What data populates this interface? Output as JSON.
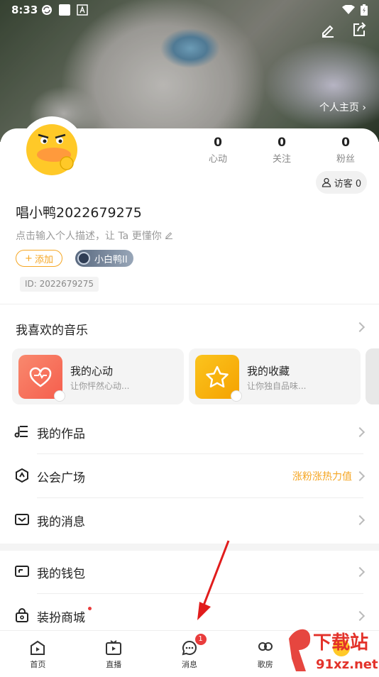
{
  "status_bar": {
    "time": "8:33"
  },
  "header": {
    "homepage_link": "个人主页"
  },
  "profile": {
    "stats": [
      {
        "num": "0",
        "label": "心动"
      },
      {
        "num": "0",
        "label": "关注"
      },
      {
        "num": "0",
        "label": "粉丝"
      }
    ],
    "visitor_label": "访客 0",
    "username": "唱小鸭2022679275",
    "description": "点击输入个人描述，让 Ta 更懂你",
    "add_label": "添加",
    "level_label": "小白鸭II",
    "uid": "ID: 2022679275"
  },
  "music": {
    "section_title": "我喜欢的音乐",
    "cards": [
      {
        "title": "我的心动",
        "subtitle": "让你怦然心动...",
        "color": "#f8725e"
      },
      {
        "title": "我的收藏",
        "subtitle": "让你独自品味...",
        "color": "#f7b514"
      }
    ]
  },
  "menu": [
    {
      "label": "我的作品",
      "tag": ""
    },
    {
      "label": "公会广场",
      "tag": "涨粉涨热力值"
    },
    {
      "label": "我的消息",
      "tag": ""
    },
    {
      "label": "我的钱包",
      "tag": ""
    },
    {
      "label": "装扮商城",
      "tag": ""
    }
  ],
  "tabbar": [
    {
      "label": "首页"
    },
    {
      "label": "直播"
    },
    {
      "label": "消息",
      "badge": "1"
    },
    {
      "label": "歌房"
    },
    {
      "label": ""
    }
  ],
  "watermark": {
    "text1": "下载站",
    "text2": "91xz.net"
  },
  "colors": {
    "accent": "#f5a623",
    "badge": "#e93c3c"
  }
}
